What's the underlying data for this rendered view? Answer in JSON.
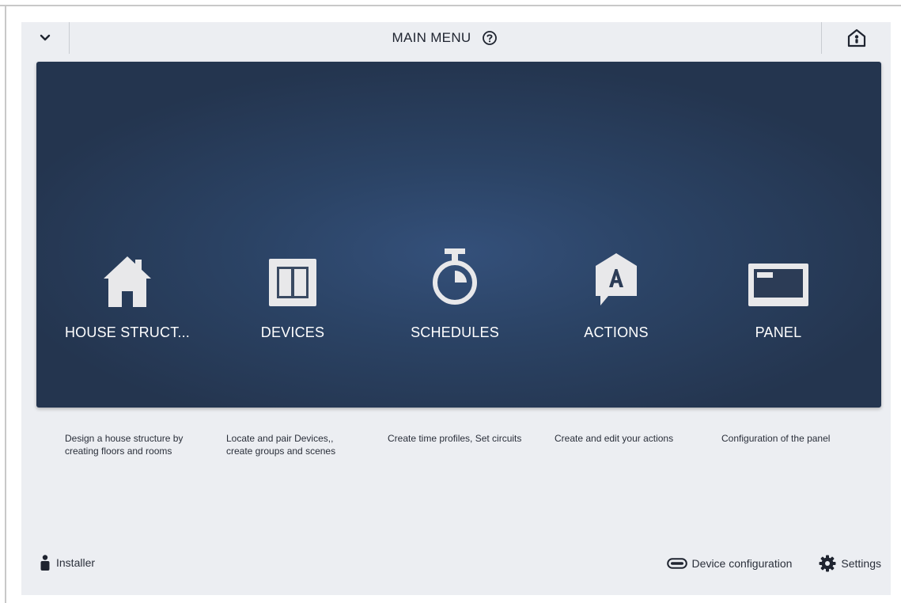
{
  "header": {
    "title": "MAIN MENU"
  },
  "tiles": [
    {
      "label": "HOUSE STRUCT...",
      "description": "Design a house structure by creating floors and rooms",
      "icon": "house-icon"
    },
    {
      "label": "DEVICES",
      "description": "Locate and pair Devices,, create groups and scenes",
      "icon": "device-switch-icon"
    },
    {
      "label": "SCHEDULES",
      "description": "Create time profiles, Set circuits",
      "icon": "stopwatch-icon"
    },
    {
      "label": "ACTIONS",
      "description": "Create and edit your actions",
      "icon": "action-tag-icon"
    },
    {
      "label": "PANEL",
      "description": "Configuration of the panel",
      "icon": "panel-icon"
    }
  ],
  "footer": {
    "user_label": "Installer",
    "device_config_label": "Device configuration",
    "settings_label": "Settings"
  },
  "colors": {
    "background": "#eceef2",
    "hero_dark": "#24354f",
    "hero_light": "#34507a",
    "icon_fill": "#e8e8ea",
    "text": "#1f2430"
  }
}
